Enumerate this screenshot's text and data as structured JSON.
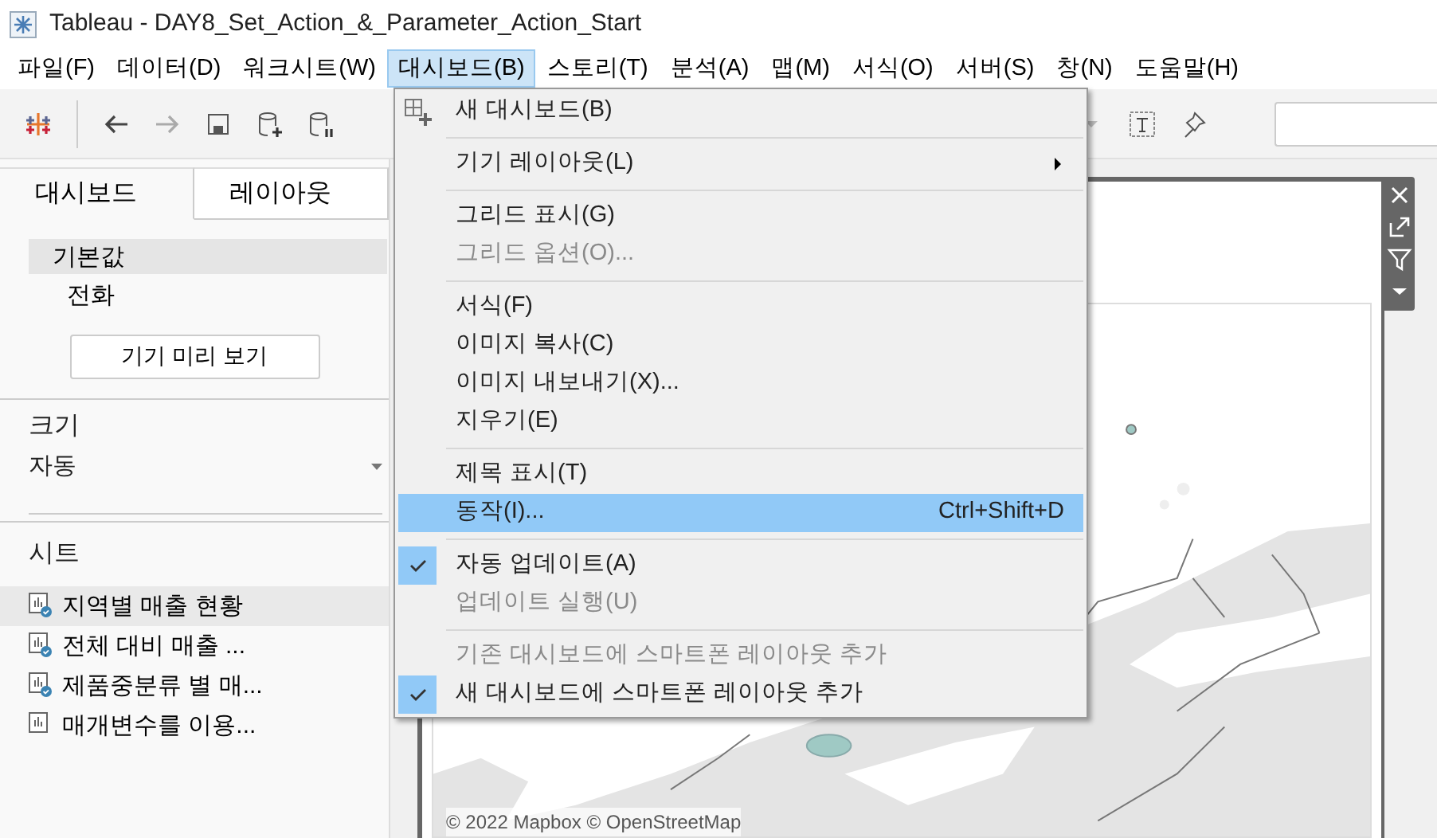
{
  "window": {
    "title": "Tableau - DAY8_Set_Action_&_Parameter_Action_Start"
  },
  "menubar": [
    {
      "label": "파일(F)",
      "selected": false
    },
    {
      "label": "데이터(D)",
      "selected": false
    },
    {
      "label": "워크시트(W)",
      "selected": false
    },
    {
      "label": "대시보드(B)",
      "selected": true
    },
    {
      "label": "스토리(T)",
      "selected": false
    },
    {
      "label": "분석(A)",
      "selected": false
    },
    {
      "label": "맵(M)",
      "selected": false
    },
    {
      "label": "서식(O)",
      "selected": false
    },
    {
      "label": "서버(S)",
      "selected": false
    },
    {
      "label": "창(N)",
      "selected": false
    },
    {
      "label": "도움말(H)",
      "selected": false
    }
  ],
  "side_panel": {
    "tabs": [
      {
        "label": "대시보드",
        "selected": true
      },
      {
        "label": "레이아웃",
        "selected": false
      }
    ],
    "devices": [
      {
        "label": "기본값",
        "selected": true
      },
      {
        "label": "전화",
        "selected": false
      }
    ],
    "preview_button": "기기 미리 보기",
    "size_label": "크기",
    "size_value": "자동",
    "sheets_label": "시트",
    "sheets": [
      {
        "label": "지역별 매출 현황",
        "used": true,
        "hovered": true
      },
      {
        "label": "전체 대비 매출 ...",
        "used": true,
        "hovered": false
      },
      {
        "label": "제품중분류 별 매...",
        "used": true,
        "hovered": false
      },
      {
        "label": "매개변수를 이용...",
        "used": false,
        "hovered": false
      }
    ]
  },
  "dashboard_menu": [
    {
      "kind": "item",
      "label": "새 대시보드(B)",
      "icon": true,
      "disabled": false,
      "checked": false,
      "selected": false
    },
    {
      "kind": "separator"
    },
    {
      "kind": "item",
      "label": "기기 레이아웃(L)",
      "submenu": true,
      "disabled": false,
      "checked": false,
      "selected": false
    },
    {
      "kind": "separator"
    },
    {
      "kind": "item",
      "label": "그리드 표시(G)",
      "disabled": false,
      "checked": false,
      "selected": false
    },
    {
      "kind": "item",
      "label": "그리드 옵션(O)...",
      "disabled": true,
      "checked": false,
      "selected": false
    },
    {
      "kind": "separator"
    },
    {
      "kind": "item",
      "label": "서식(F)",
      "disabled": false,
      "checked": false,
      "selected": false
    },
    {
      "kind": "item",
      "label": "이미지 복사(C)",
      "disabled": false,
      "checked": false,
      "selected": false
    },
    {
      "kind": "item",
      "label": "이미지 내보내기(X)...",
      "disabled": false,
      "checked": false,
      "selected": false
    },
    {
      "kind": "item",
      "label": "지우기(E)",
      "disabled": false,
      "checked": false,
      "selected": false
    },
    {
      "kind": "separator"
    },
    {
      "kind": "item",
      "label": "제목 표시(T)",
      "disabled": false,
      "checked": false,
      "selected": false
    },
    {
      "kind": "item",
      "label": "동작(I)...",
      "shortcut": "Ctrl+Shift+D",
      "disabled": false,
      "checked": false,
      "selected": true
    },
    {
      "kind": "separator"
    },
    {
      "kind": "item",
      "label": "자동 업데이트(A)",
      "disabled": false,
      "checked": true,
      "selected": false
    },
    {
      "kind": "item",
      "label": "업데이트 실행(U)",
      "disabled": true,
      "checked": false,
      "selected": false
    },
    {
      "kind": "separator"
    },
    {
      "kind": "item",
      "label": "기존 대시보드에 스마트폰 레이아웃 추가",
      "disabled": true,
      "checked": false,
      "selected": false
    },
    {
      "kind": "item",
      "label": "새 대시보드에 스마트폰 레이아웃 추가",
      "disabled": false,
      "checked": true,
      "selected": false
    }
  ],
  "map": {
    "kind": "picture",
    "attribution": "© 2022 Mapbox © OpenStreetMap"
  }
}
